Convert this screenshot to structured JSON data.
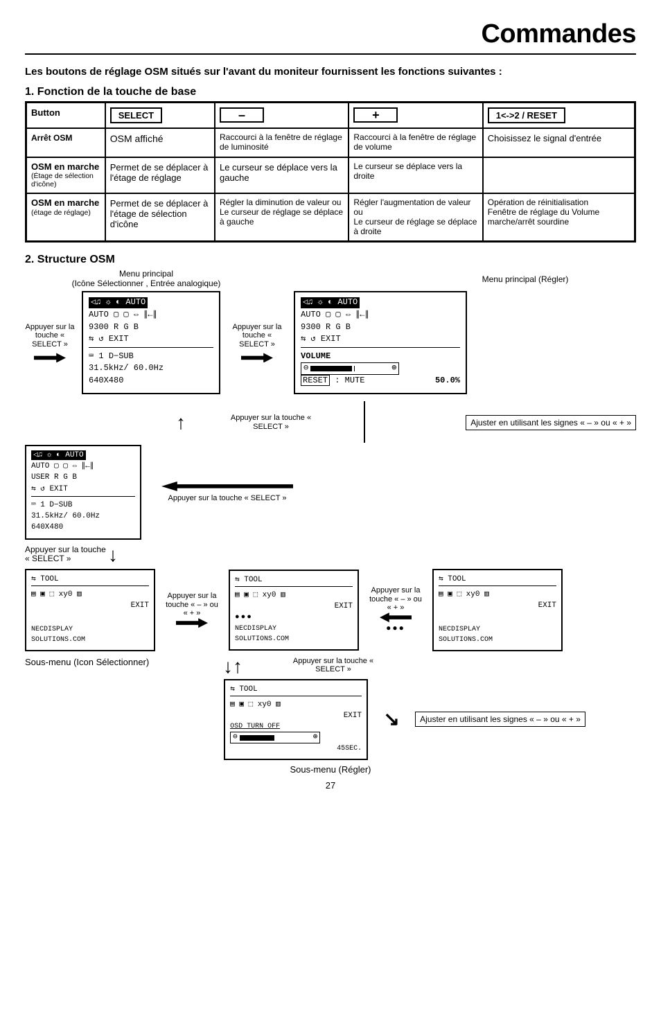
{
  "page_title": "Commandes",
  "intro_text": "Les boutons de réglage OSM situés sur l'avant du moniteur fournissent les fonctions suivantes :",
  "section1_title": "1. Fonction de la touche de base",
  "table": {
    "h_button": "Button",
    "h_select": "SELECT",
    "h_minus": "–",
    "h_plus": "+",
    "h_reset": "1<->2 / RESET",
    "r1": {
      "c1": "Arrêt OSM",
      "c2": "OSM affiché",
      "c3": "Raccourci à la fenêtre de réglage de luminosité",
      "c4": "Raccourci à la fenêtre de réglage de volume",
      "c5": "Choisissez le signal d'entrée"
    },
    "r2": {
      "c1_a": "OSM en marche",
      "c1_b": "(Étage de sélection d'icône)",
      "c2": "Permet de se déplacer à l'étage de réglage",
      "c3": "Le curseur se déplace vers la gauche",
      "c4": "Le curseur se déplace vers la droite",
      "c5": ""
    },
    "r3": {
      "c1_a": "OSM en marche",
      "c1_b": "(étage de réglage)",
      "c2": "Permet de se déplacer à l'étage de sélection d'icône",
      "c3": "Régler la diminution de valeur ou\nLe curseur de réglage se déplace à gauche",
      "c4": "Régler l'augmentation de valeur ou\nLe curseur de réglage se déplace à droite",
      "c5": "Opération de réinitialisation\nFenêtre de réglage du Volume marche/arrêt sourdine"
    }
  },
  "section2_title": "2. Structure OSM",
  "labels": {
    "menu_principal1": "Menu principal",
    "menu_principal1_sub": "(Icône Sélectionner , Entrée analogique)",
    "menu_principal2": "Menu principal (Régler)",
    "press_select1": "Appuyer sur la touche « SELECT »",
    "press_select2": "Appuyer sur la touche « SELECT »",
    "press_select_center1": "Appuyer sur la touche « SELECT »",
    "press_select_center2": "Appuyer sur la touche « SELECT »",
    "press_select_la": "Appuyer sur la touche « SELECT »",
    "press_pm1": "Appuyer sur la touche « – » ou « + »",
    "press_pm2": "Appuyer sur la touche « – » ou « + »",
    "adjust_hint": "Ajuster en utilisant les signes « – » ou « + »",
    "sub_icon": "Sous-menu (Icon Sélectionner)",
    "sub_regler": "Sous-menu (Régler)"
  },
  "osd_main1": {
    "row_top": "◁♫  ☼   ◐  AUTO",
    "row_top2": "AUTO  ▢   ▢   ⇔  ∥←∥",
    "row3": "9300  R   G   B",
    "row4": "⇆    ↺           EXIT",
    "row5": "⌨  1  D−SUB",
    "row6": " 31.5kHz/  60.0Hz",
    "row7": "     640X480"
  },
  "osd_main2": {
    "row_top": "◁♫  ☼   ◐  AUTO",
    "row_top2": "AUTO  ▢   ▢   ⇔  ∥←∥",
    "row3": "9300  R   G   B",
    "row4": "⇆    ↺           EXIT",
    "vol": "       VOLUME",
    "bar_left": "⊖",
    "bar_right": "⊕",
    "mute": "RESET : MUTE",
    "pct": "50.0%"
  },
  "osd_small": {
    "row_top": "◁♫ ☼  ◐ AUTO",
    "row2": "AUTO ▢ ▢ ⇔ ∥←∥",
    "row3": "USER R  G  B",
    "row4": "⇆  ↺       EXIT",
    "row5": "⌨ 1 D−SUB",
    "row6": "31.5kHz/ 60.0Hz",
    "row7": "    640X480"
  },
  "osd_tool_a": {
    "line1": "⇆   TOOL",
    "line2": "▤  ▣  ⬚  xy0   ▥",
    "line3": "                EXIT",
    "line4": "NECDISPLAY",
    "line5": "   SOLUTIONS.COM"
  },
  "osd_tool_b": {
    "line1": "⇆   TOOL",
    "line2": "▤  ▣  ⬚  xy0   ▥",
    "line3": "                EXIT",
    "line4": "NECDISPLAY",
    "line5": "   SOLUTIONS.COM"
  },
  "osd_tool_c": {
    "line1": "⇆   TOOL",
    "line2": "▤  ▣  ⬚  xy0   ▥",
    "line3": "                EXIT",
    "line4": "NECDISPLAY",
    "line5": "   SOLUTIONS.COM"
  },
  "osd_tool_d": {
    "line1": "⇆   TOOL",
    "line2": "▤  ▣  ⬚  xy0   ▥",
    "line3": "                EXIT",
    "line4": "OSD TURN OFF",
    "bar_left": "⊖",
    "bar_right": "⊕",
    "line5": "         45SEC."
  },
  "dots": "●●●",
  "page_number": "27"
}
